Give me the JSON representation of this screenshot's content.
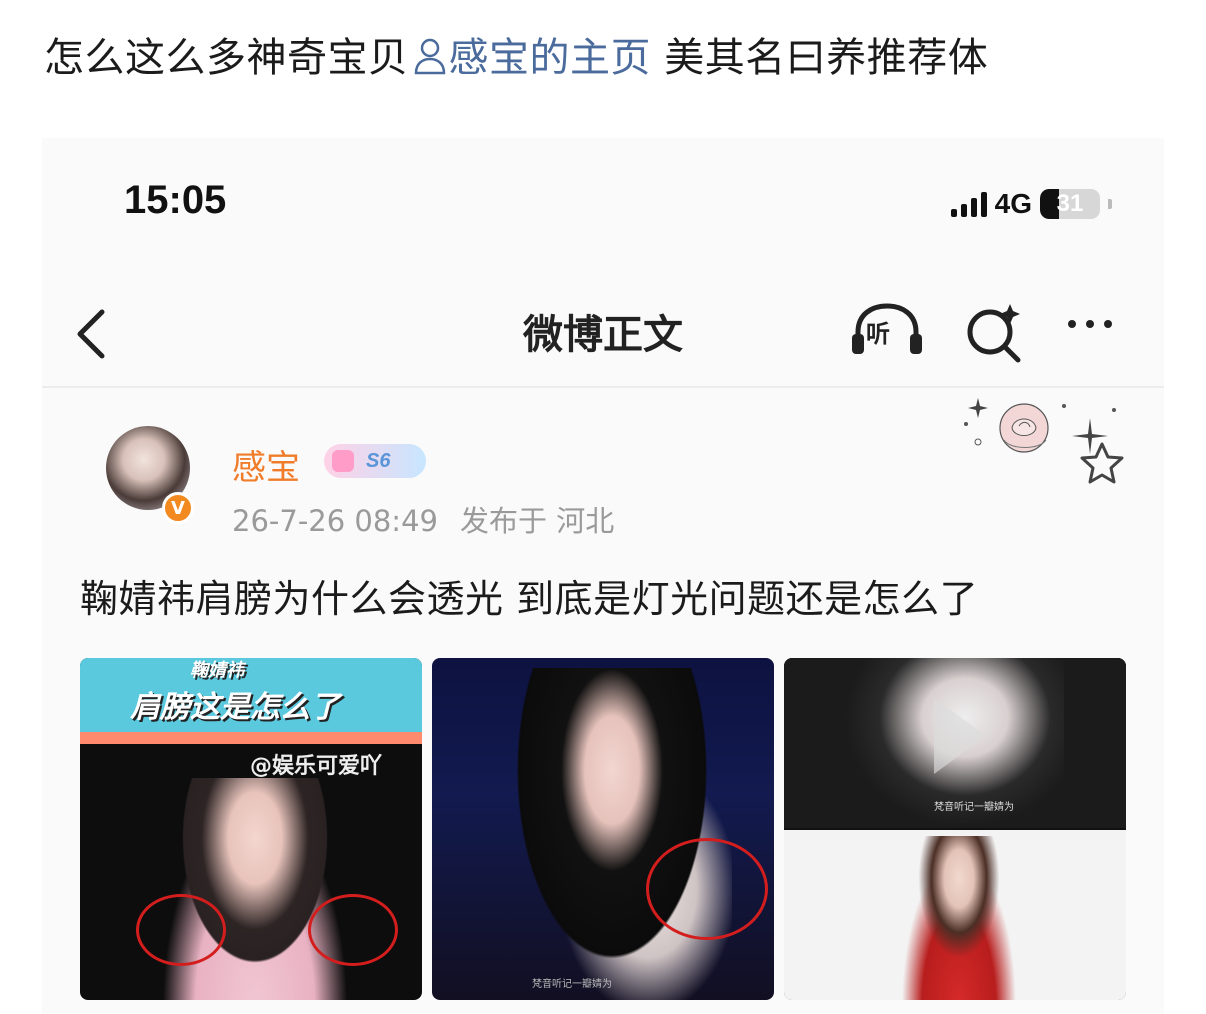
{
  "headline": {
    "prefix": "怎么这么多神奇宝贝",
    "link": "感宝的主页",
    "suffix": " 美其名曰养推荐体"
  },
  "status_bar": {
    "time": "15:05",
    "network": "4G",
    "battery": "31",
    "battery_level": 0.31
  },
  "nav": {
    "title": "微博正文",
    "listen_label": "听",
    "icons": [
      "back-arrow-icon",
      "headphones-icon",
      "search-sparkle-icon",
      "more-dots-icon"
    ]
  },
  "post": {
    "username": "感宝",
    "level": "S6",
    "time": "26-7-26 08:49",
    "location": "发布于 河北",
    "text": "鞠婧祎肩膀为什么会透光 到底是灯光问题还是怎么了",
    "images": [
      {
        "caption_top": "鞠婧祎",
        "caption": "肩膀这是怎么了",
        "watermark": "@娱乐可爱吖"
      },
      {
        "watermark": "梵音听记一瓣婧为"
      },
      {
        "watermark": "梵音听记一瓣婧为"
      }
    ]
  },
  "colors": {
    "link": "#4a6b9c",
    "username": "#f07c2a",
    "vbadge": "#f28a1f",
    "circle": "#d41e1e"
  }
}
